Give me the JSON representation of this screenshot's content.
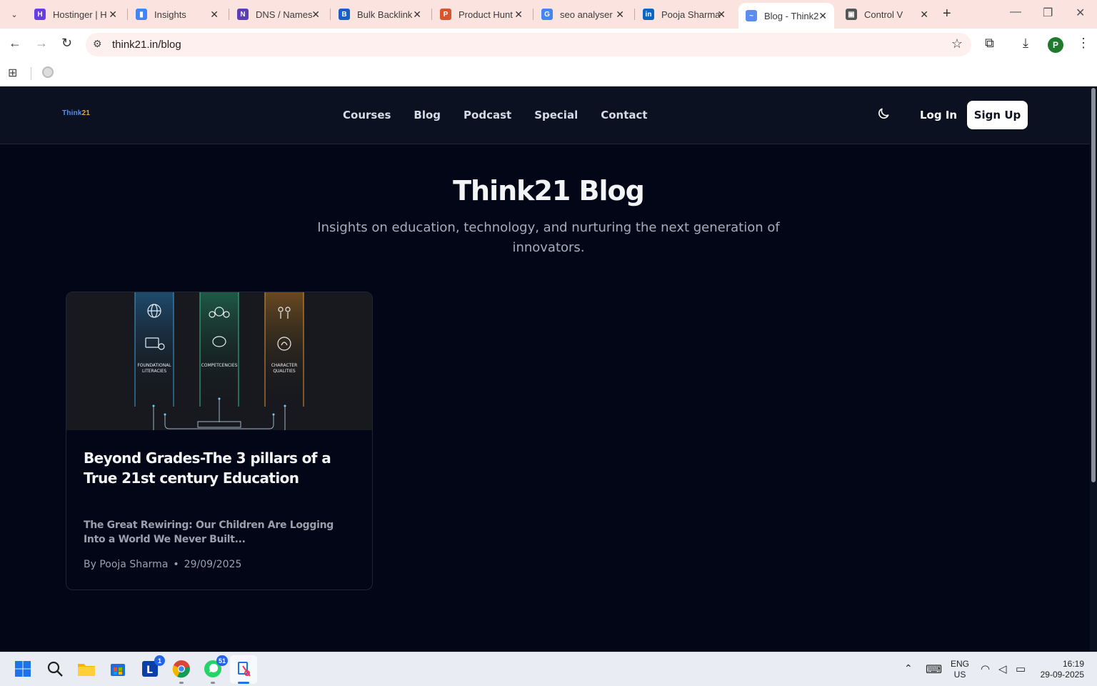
{
  "browser": {
    "tabs": [
      {
        "title": "Hostinger | H",
        "color": "#673de6",
        "glyph": "H"
      },
      {
        "title": "Insights",
        "color": "#4285f4",
        "glyph": "▮"
      },
      {
        "title": "DNS / Names",
        "color": "#5b3fb8",
        "glyph": "N"
      },
      {
        "title": "Bulk Backlink",
        "color": "#1a5fc9",
        "glyph": "B"
      },
      {
        "title": "Product Hunt",
        "color": "#da552f",
        "glyph": "P"
      },
      {
        "title": "seo analyser",
        "color": "#4285f4",
        "glyph": "G"
      },
      {
        "title": "Pooja Sharma",
        "color": "#0a66c2",
        "glyph": "in"
      },
      {
        "title": "Blog - Think2",
        "color": "#5b8def",
        "glyph": "~"
      },
      {
        "title": "Control V",
        "color": "#555555",
        "glyph": "▣"
      }
    ],
    "active_tab_index": 7,
    "address": "think21.in/blog",
    "profile_initial": "P"
  },
  "site": {
    "logo_prefix": "Think",
    "logo_suffix": "21",
    "nav": [
      {
        "label": "Courses"
      },
      {
        "label": "Blog"
      },
      {
        "label": "Podcast"
      },
      {
        "label": "Special"
      },
      {
        "label": "Contact"
      }
    ],
    "login_label": "Log In",
    "signup_label": "Sign Up",
    "page_title": "Think21 Blog",
    "page_subtitle": "Insights on education, technology, and nurturing the next generation of innovators.",
    "posts": [
      {
        "image_labels": [
          "FOUNDATIONAL\nLITERACIES",
          "COMPETCENCIES",
          "CHARACTER\nQUALITIES"
        ],
        "title": "Beyond Grades-The 3 pillars of a True 21st century Education",
        "excerpt": "The Great Rewiring: Our Children Are Logging Into a World We Never Built...",
        "author": "By Pooja Sharma",
        "date": "29/09/2025"
      }
    ]
  },
  "taskbar": {
    "whatsapp_badge": "51",
    "teams_badge": "1",
    "lang_line1": "ENG",
    "lang_line2": "US",
    "time": "16:19",
    "date": "29-09-2025"
  }
}
